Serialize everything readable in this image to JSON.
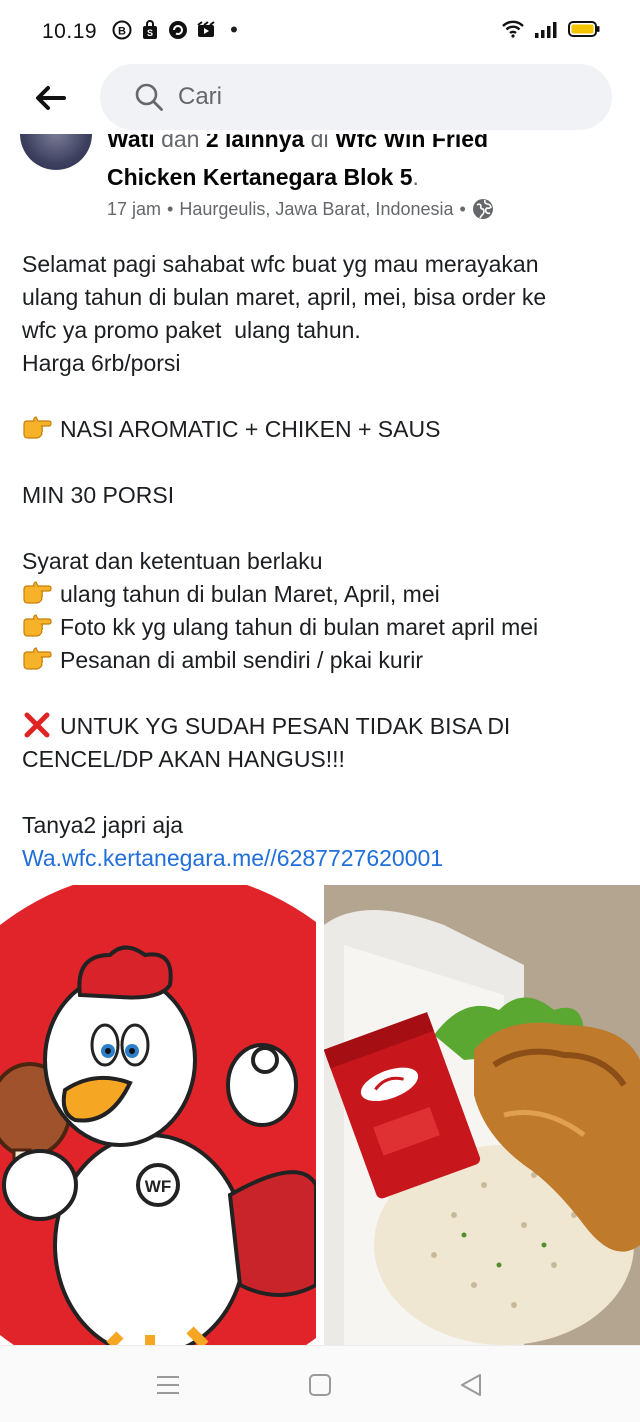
{
  "status_bar": {
    "time": "10.19",
    "dot": "•"
  },
  "search": {
    "placeholder": "Cari"
  },
  "post": {
    "author_title_line1_bold_a": "Wati",
    "author_title_line1_light_a": " dan ",
    "author_title_line1_bold_b": "2 lainnya",
    "author_title_line1_light_b": " di ",
    "author_title_line1_bold_c": "Wfc Win Fried",
    "author_title_line2": "Chicken Kertanegara Blok 5",
    "author_title_period": ".",
    "time_ago": "17 jam",
    "separator": "•",
    "location": "Haurgeulis, Jawa Barat, Indonesia",
    "separator2": "•",
    "body": {
      "l1": "Selamat pagi sahabat wfc buat yg mau merayakan",
      "l2": "ulang tahun di bulan maret, april, mei, bisa order ke",
      "l3": "wfc ya promo paket  ulang tahun.",
      "l4": "Harga 6rb/porsi",
      "l5": "NASI AROMATIC + CHIKEN + SAUS",
      "l6": "MIN 30 PORSI",
      "l7": "Syarat dan ketentuan berlaku",
      "l8": "ulang tahun di bulan Maret, April, mei",
      "l9": "Foto kk yg ulang tahun di bulan maret april mei",
      "l10": "Pesanan di ambil sendiri / pkai kurir",
      "l11": "UNTUK YG SUDAH PESAN TIDAK BISA DI",
      "l12": "CENCEL/DP AKAN HANGUS!!!",
      "l13": "Tanya2 japri aja",
      "link": "Wa.wfc.kertanegara.me//6287727620001"
    },
    "photo_left_logo_text": "WF"
  },
  "colors": {
    "link": "#216fdb",
    "meta": "#65676b",
    "search_bg": "#f0f2f5",
    "mascot_red": "#e0242a"
  },
  "icons": {
    "back": "arrow-left-icon",
    "search": "search-icon",
    "globe": "globe-icon",
    "point": "pointing-right-emoji",
    "cross": "cross-mark-emoji",
    "nav_menu": "menu-icon",
    "nav_home": "square-home-icon",
    "nav_back": "triangle-back-icon"
  }
}
